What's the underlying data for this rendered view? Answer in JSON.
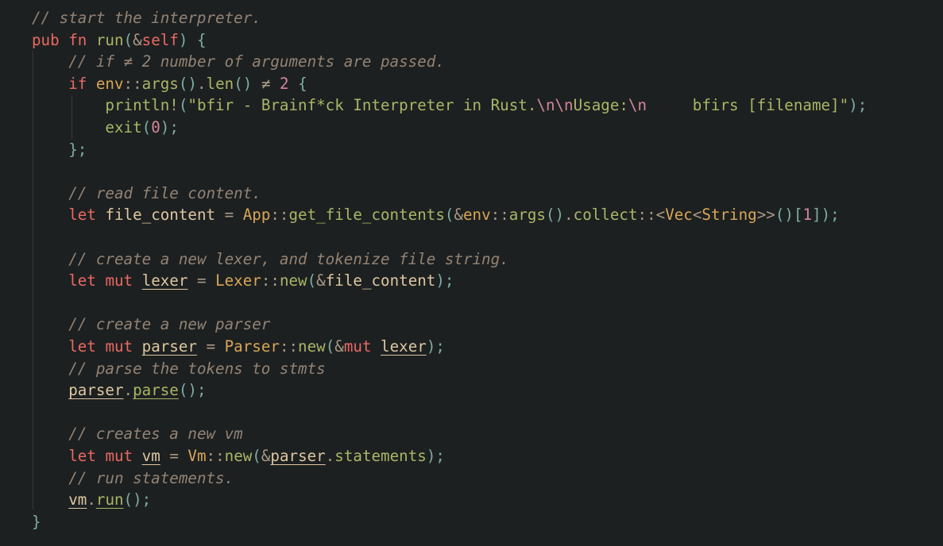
{
  "theme": {
    "background": "#1d2021",
    "comment": "#928374",
    "keyword": "#ea6962",
    "function": "#a9b665",
    "string": "#a9b665",
    "escape": "#d3869b",
    "number": "#d3869b",
    "type": "#d8a657",
    "punctuation": "#7daea3",
    "variable": "#ddc7a1"
  },
  "lines": [
    [
      {
        "t": "// start the interpreter.",
        "c": "t-comment"
      }
    ],
    [
      {
        "t": "pub ",
        "c": "t-kw"
      },
      {
        "t": "fn ",
        "c": "t-kw"
      },
      {
        "t": "run",
        "c": "t-fn"
      },
      {
        "t": "(",
        "c": "t-punc"
      },
      {
        "t": "&",
        "c": "t-op"
      },
      {
        "t": "self",
        "c": "t-self"
      },
      {
        "t": ")",
        "c": "t-punc"
      },
      {
        "t": " {",
        "c": "t-punc"
      }
    ],
    [
      {
        "t": "    ",
        "c": "t-plain"
      },
      {
        "t": "// if ≠ 2 number of arguments are passed.",
        "c": "t-comment"
      }
    ],
    [
      {
        "t": "    ",
        "c": "t-plain"
      },
      {
        "t": "if ",
        "c": "t-kw"
      },
      {
        "t": "env",
        "c": "t-mod"
      },
      {
        "t": "::",
        "c": "t-op"
      },
      {
        "t": "args",
        "c": "t-fn"
      },
      {
        "t": "()",
        "c": "t-punc"
      },
      {
        "t": ".",
        "c": "t-op"
      },
      {
        "t": "len",
        "c": "t-fn"
      },
      {
        "t": "()",
        "c": "t-punc"
      },
      {
        "t": " ≠ ",
        "c": "t-op"
      },
      {
        "t": "2",
        "c": "t-num"
      },
      {
        "t": " {",
        "c": "t-punc"
      }
    ],
    [
      {
        "t": "        ",
        "c": "t-plain"
      },
      {
        "t": "println!",
        "c": "t-macro"
      },
      {
        "t": "(",
        "c": "t-punc"
      },
      {
        "t": "\"bfir - Brainf*ck Interpreter in Rust.",
        "c": "t-str"
      },
      {
        "t": "\\n\\n",
        "c": "t-esc"
      },
      {
        "t": "Usage:",
        "c": "t-str"
      },
      {
        "t": "\\n",
        "c": "t-esc"
      },
      {
        "t": "     bfirs [filename]\"",
        "c": "t-str"
      },
      {
        "t": ");",
        "c": "t-punc"
      }
    ],
    [
      {
        "t": "        ",
        "c": "t-plain"
      },
      {
        "t": "exit",
        "c": "t-fn"
      },
      {
        "t": "(",
        "c": "t-punc"
      },
      {
        "t": "0",
        "c": "t-num"
      },
      {
        "t": ");",
        "c": "t-punc"
      }
    ],
    [
      {
        "t": "    ",
        "c": "t-plain"
      },
      {
        "t": "};",
        "c": "t-punc"
      }
    ],
    [
      {
        "t": "",
        "c": "t-plain"
      }
    ],
    [
      {
        "t": "    ",
        "c": "t-plain"
      },
      {
        "t": "// read file content.",
        "c": "t-comment"
      }
    ],
    [
      {
        "t": "    ",
        "c": "t-plain"
      },
      {
        "t": "let ",
        "c": "t-kw"
      },
      {
        "t": "file_content",
        "c": "t-var"
      },
      {
        "t": " = ",
        "c": "t-op"
      },
      {
        "t": "App",
        "c": "t-type"
      },
      {
        "t": "::",
        "c": "t-op"
      },
      {
        "t": "get_file_contents",
        "c": "t-fn"
      },
      {
        "t": "(",
        "c": "t-punc"
      },
      {
        "t": "&",
        "c": "t-op"
      },
      {
        "t": "env",
        "c": "t-mod"
      },
      {
        "t": "::",
        "c": "t-op"
      },
      {
        "t": "args",
        "c": "t-fn"
      },
      {
        "t": "()",
        "c": "t-punc"
      },
      {
        "t": ".",
        "c": "t-op"
      },
      {
        "t": "collect",
        "c": "t-fn"
      },
      {
        "t": "::<",
        "c": "t-op"
      },
      {
        "t": "Vec",
        "c": "t-type"
      },
      {
        "t": "<",
        "c": "t-op"
      },
      {
        "t": "String",
        "c": "t-type"
      },
      {
        "t": ">>",
        "c": "t-op"
      },
      {
        "t": "()",
        "c": "t-punc"
      },
      {
        "t": "[",
        "c": "t-punc"
      },
      {
        "t": "1",
        "c": "t-num"
      },
      {
        "t": "]",
        "c": "t-punc"
      },
      {
        "t": ");",
        "c": "t-punc"
      }
    ],
    [
      {
        "t": "",
        "c": "t-plain"
      }
    ],
    [
      {
        "t": "    ",
        "c": "t-plain"
      },
      {
        "t": "// create a new lexer, and tokenize file string.",
        "c": "t-comment"
      }
    ],
    [
      {
        "t": "    ",
        "c": "t-plain"
      },
      {
        "t": "let ",
        "c": "t-kw"
      },
      {
        "t": "mut ",
        "c": "t-kw"
      },
      {
        "t": "lexer",
        "c": "t-mutvar"
      },
      {
        "t": " = ",
        "c": "t-op"
      },
      {
        "t": "Lexer",
        "c": "t-type"
      },
      {
        "t": "::",
        "c": "t-op"
      },
      {
        "t": "new",
        "c": "t-fn"
      },
      {
        "t": "(",
        "c": "t-punc"
      },
      {
        "t": "&",
        "c": "t-op"
      },
      {
        "t": "file_content",
        "c": "t-var"
      },
      {
        "t": ");",
        "c": "t-punc"
      }
    ],
    [
      {
        "t": "",
        "c": "t-plain"
      }
    ],
    [
      {
        "t": "    ",
        "c": "t-plain"
      },
      {
        "t": "// create a new parser",
        "c": "t-comment"
      }
    ],
    [
      {
        "t": "    ",
        "c": "t-plain"
      },
      {
        "t": "let ",
        "c": "t-kw"
      },
      {
        "t": "mut ",
        "c": "t-kw"
      },
      {
        "t": "parser",
        "c": "t-mutvar"
      },
      {
        "t": " = ",
        "c": "t-op"
      },
      {
        "t": "Parser",
        "c": "t-type"
      },
      {
        "t": "::",
        "c": "t-op"
      },
      {
        "t": "new",
        "c": "t-fn"
      },
      {
        "t": "(",
        "c": "t-punc"
      },
      {
        "t": "&",
        "c": "t-op"
      },
      {
        "t": "mut ",
        "c": "t-kw"
      },
      {
        "t": "lexer",
        "c": "t-mutvar"
      },
      {
        "t": ");",
        "c": "t-punc"
      }
    ],
    [
      {
        "t": "    ",
        "c": "t-plain"
      },
      {
        "t": "// parse the tokens to stmts",
        "c": "t-comment"
      }
    ],
    [
      {
        "t": "    ",
        "c": "t-plain"
      },
      {
        "t": "parser",
        "c": "t-mutvar"
      },
      {
        "t": ".",
        "c": "t-op"
      },
      {
        "t": "parse",
        "c": "t-mutfn"
      },
      {
        "t": "();",
        "c": "t-punc"
      }
    ],
    [
      {
        "t": "",
        "c": "t-plain"
      }
    ],
    [
      {
        "t": "    ",
        "c": "t-plain"
      },
      {
        "t": "// creates a new vm",
        "c": "t-comment"
      }
    ],
    [
      {
        "t": "    ",
        "c": "t-plain"
      },
      {
        "t": "let ",
        "c": "t-kw"
      },
      {
        "t": "mut ",
        "c": "t-kw"
      },
      {
        "t": "vm",
        "c": "t-mutvar"
      },
      {
        "t": " = ",
        "c": "t-op"
      },
      {
        "t": "Vm",
        "c": "t-type"
      },
      {
        "t": "::",
        "c": "t-op"
      },
      {
        "t": "new",
        "c": "t-fn"
      },
      {
        "t": "(",
        "c": "t-punc"
      },
      {
        "t": "&",
        "c": "t-op"
      },
      {
        "t": "parser",
        "c": "t-mutvar"
      },
      {
        "t": ".",
        "c": "t-op"
      },
      {
        "t": "statements",
        "c": "t-fn"
      },
      {
        "t": ");",
        "c": "t-punc"
      }
    ],
    [
      {
        "t": "    ",
        "c": "t-plain"
      },
      {
        "t": "// run statements.",
        "c": "t-comment"
      }
    ],
    [
      {
        "t": "    ",
        "c": "t-plain"
      },
      {
        "t": "vm",
        "c": "t-mutvar"
      },
      {
        "t": ".",
        "c": "t-op"
      },
      {
        "t": "run",
        "c": "t-mutfn"
      },
      {
        "t": "();",
        "c": "t-punc"
      }
    ],
    [
      {
        "t": "}",
        "c": "t-punc"
      }
    ]
  ]
}
